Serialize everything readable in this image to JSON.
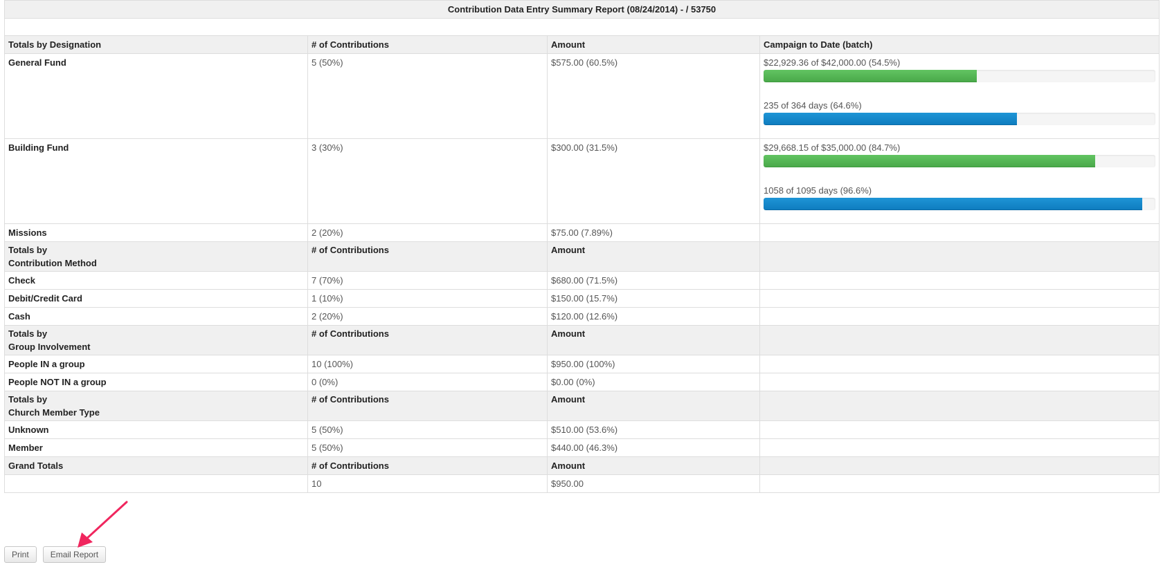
{
  "report": {
    "title": "Contribution Data Entry Summary Report (08/24/2014) - / 53750"
  },
  "designation": {
    "headers": [
      "Totals by Designation",
      "# of Contributions",
      "Amount",
      "Campaign to Date (batch)"
    ],
    "rows": [
      {
        "name": "General Fund",
        "count": "5  (50%)",
        "amount": "$575.00  (60.5%)",
        "campaign": {
          "amount_label": "$22,929.36 of $42,000.00 (54.5%)",
          "amount_pct": 54.5,
          "days_label": "235 of 364 days (64.6%)",
          "days_pct": 64.6
        }
      },
      {
        "name": "Building Fund",
        "count": "3  (30%)",
        "amount": "$300.00  (31.5%)",
        "campaign": {
          "amount_label": "$29,668.15 of $35,000.00 (84.7%)",
          "amount_pct": 84.7,
          "days_label": "1058 of 1095 days (96.6%)",
          "days_pct": 96.6
        }
      },
      {
        "name": "Missions",
        "count": "2  (20%)",
        "amount": "$75.00  (7.89%)"
      }
    ]
  },
  "method": {
    "header_line1": "Totals by",
    "header_line2": "Contribution Method",
    "count_header": "# of Contributions",
    "amount_header": "Amount",
    "rows": [
      {
        "name": "Check",
        "count": "7  (70%)",
        "amount": "$680.00  (71.5%)"
      },
      {
        "name": "Debit/Credit Card",
        "count": "1  (10%)",
        "amount": "$150.00  (15.7%)"
      },
      {
        "name": "Cash",
        "count": "2  (20%)",
        "amount": "$120.00  (12.6%)"
      }
    ]
  },
  "group": {
    "header_line1": "Totals by",
    "header_line2": "Group Involvement",
    "count_header": "# of Contributions",
    "amount_header": "Amount",
    "rows": [
      {
        "name": "People IN a group",
        "count": "10  (100%)",
        "amount": "$950.00  (100%)"
      },
      {
        "name": "People NOT IN a group",
        "count": "0  (0%)",
        "amount": "$0.00  (0%)"
      }
    ]
  },
  "member": {
    "header_line1": "Totals by",
    "header_line2": "Church Member Type",
    "count_header": "# of Contributions",
    "amount_header": "Amount",
    "rows": [
      {
        "name": "Unknown",
        "count": "5  (50%)",
        "amount": "$510.00  (53.6%)"
      },
      {
        "name": "Member",
        "count": "5  (50%)",
        "amount": "$440.00  (46.3%)"
      }
    ]
  },
  "grand": {
    "header": "Grand Totals",
    "count_header": "# of Contributions",
    "amount_header": "Amount",
    "count": "10",
    "amount": "$950.00"
  },
  "buttons": {
    "print": "Print",
    "email": "Email Report"
  },
  "colors": {
    "amount_bar": "#5cb85c",
    "days_bar": "#1a8fd0",
    "annotation_arrow": "#f0265e"
  }
}
